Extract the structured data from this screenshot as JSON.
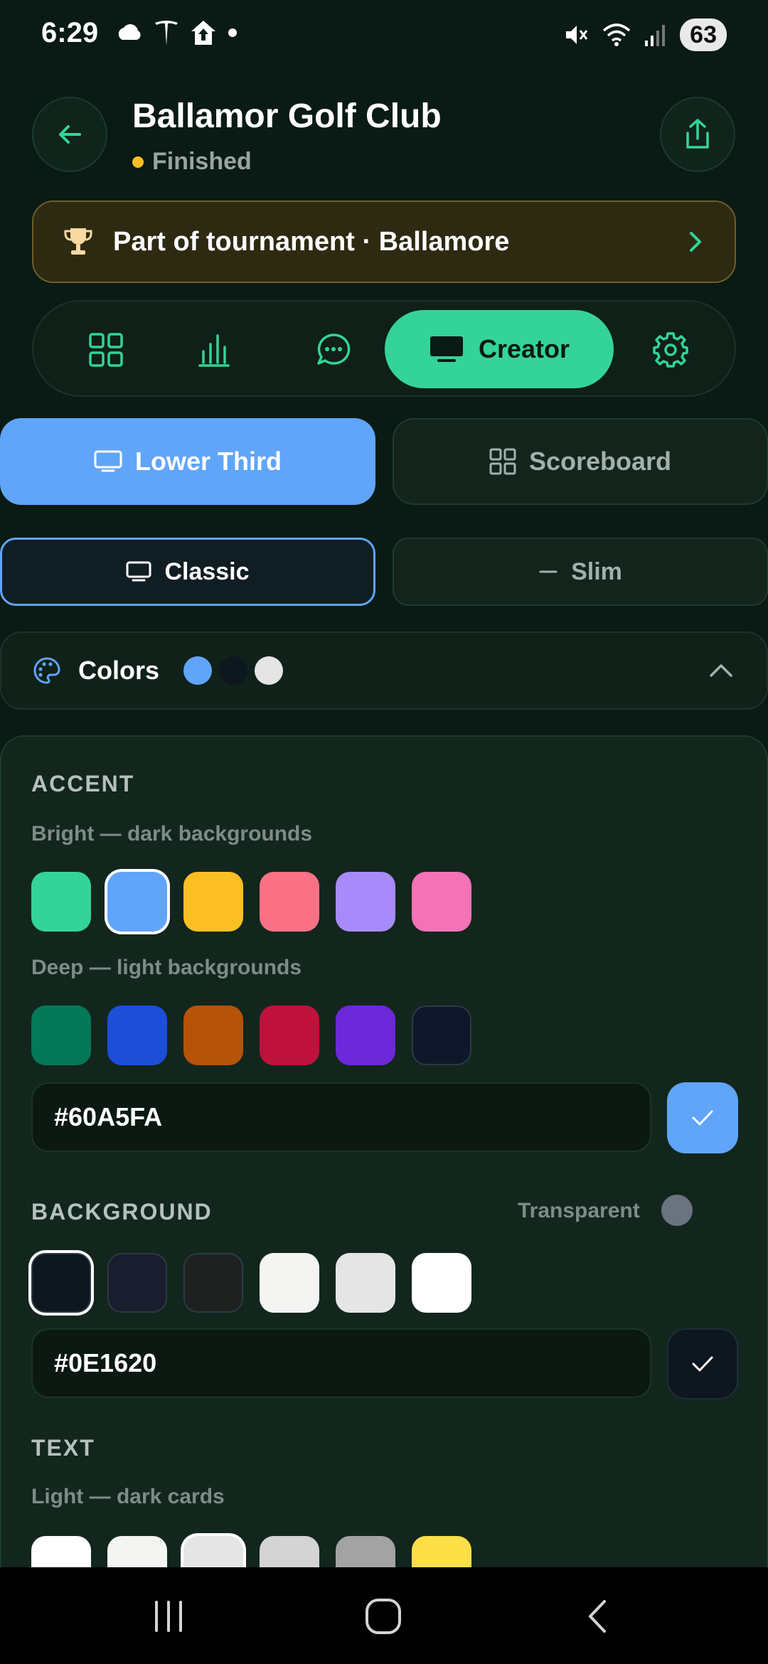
{
  "status_bar": {
    "time": "6:29",
    "battery": "63",
    "left_icons": [
      "cloud-icon",
      "tesla-icon",
      "home-upload-icon",
      "dot-icon"
    ],
    "right_icons": [
      "mute-icon",
      "wifi-icon",
      "signal-icon"
    ]
  },
  "header": {
    "title": "Ballamor Golf Club",
    "status": "Finished",
    "status_color": "#fbbf24"
  },
  "tournament": {
    "label": "Part of tournament · Ballamore"
  },
  "tabs": {
    "items": [
      "grid-icon",
      "bar-chart-icon",
      "chat-icon",
      "creator",
      "settings-icon"
    ],
    "active_label": "Creator"
  },
  "modes": {
    "lower_third": "Lower Third",
    "scoreboard": "Scoreboard",
    "active": "Lower Third"
  },
  "styles": {
    "classic": "Classic",
    "slim": "Slim",
    "active": "Classic"
  },
  "colors_section": {
    "title": "Colors",
    "preview": [
      "#60a5fa",
      "#0e1620",
      "#e5e5e5"
    ]
  },
  "accent": {
    "title": "ACCENT",
    "bright_label": "Bright — dark backgrounds",
    "bright": [
      "#34d399",
      "#60a5fa",
      "#fbbf24",
      "#fb7185",
      "#a78bfa",
      "#f472b6"
    ],
    "bright_selected": 1,
    "deep_label": "Deep — light backgrounds",
    "deep": [
      "#047857",
      "#1d4ed8",
      "#b45309",
      "#be123c",
      "#6d28d9",
      "#0f172a"
    ],
    "hex": "#60A5FA",
    "apply_color": "#60a5fa"
  },
  "background": {
    "title": "BACKGROUND",
    "transparent_label": "Transparent",
    "swatches": [
      "#0e1620",
      "#1a1d2e",
      "#1f2020",
      "#f4f4f2",
      "#e5e5e5",
      "#ffffff"
    ],
    "selected": 0,
    "hex": "#0E1620",
    "apply_color": "#0e1620"
  },
  "text": {
    "title": "TEXT",
    "light_label": "Light — dark cards",
    "swatches": [
      "#ffffff",
      "#f4f4f2",
      "#e5e5e5",
      "#d4d4d4",
      "#a3a3a3",
      "#fde047"
    ],
    "selected": 2
  }
}
